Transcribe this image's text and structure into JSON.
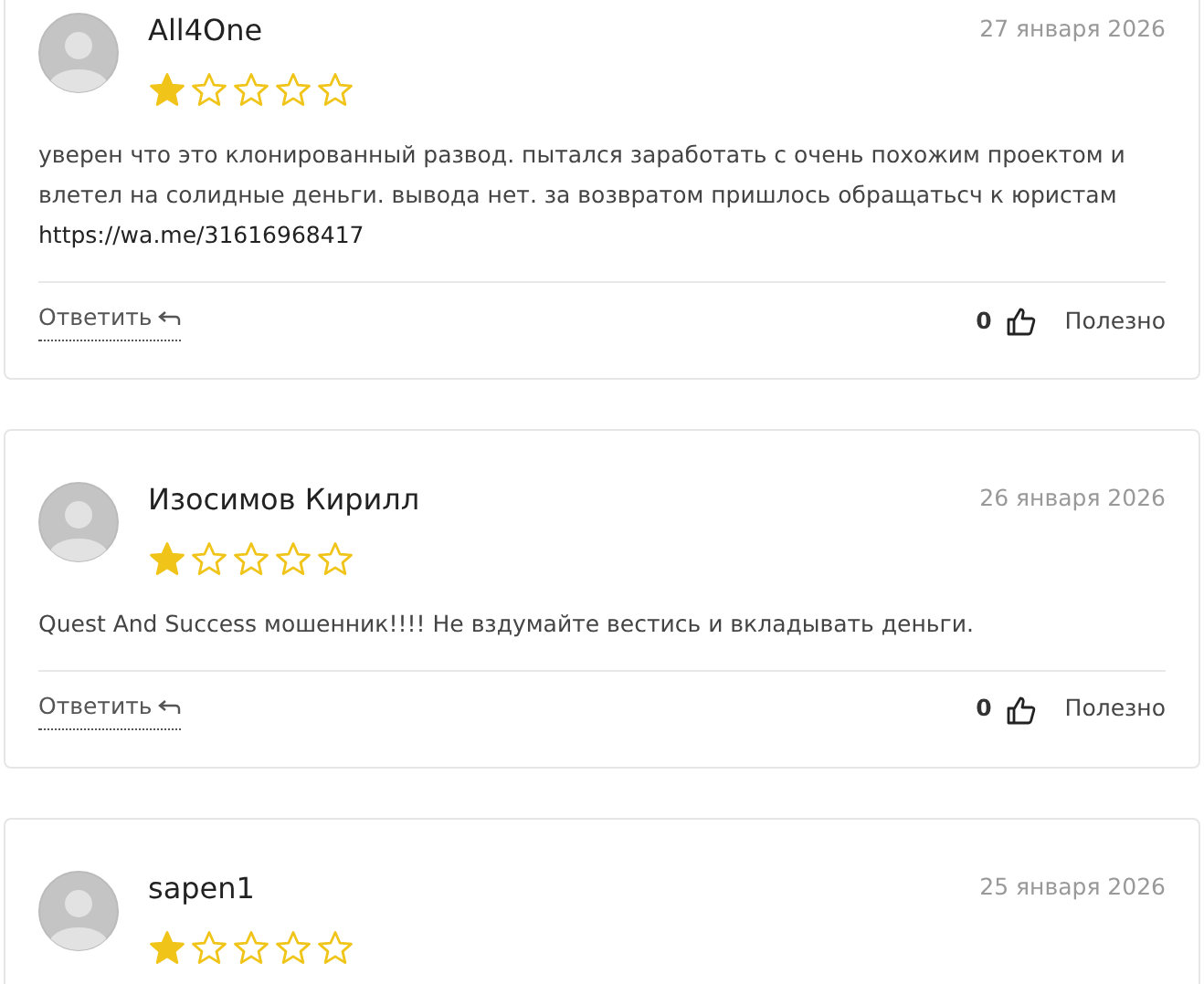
{
  "reviews": [
    {
      "author": "All4One",
      "date": "27 января 2026",
      "stars": 1,
      "text": "уверен что это клонированный развод. пытался заработать с очень похожим проектом и влетел на солидные деньги. вывода нет. за возвратом пришлось обращатьсч к юристам",
      "link": "https://wa.me/31616968417",
      "reply": "Ответить",
      "likes": "0",
      "helpful": "Полезно"
    },
    {
      "author": "Изосимов Кирилл",
      "date": "26 января 2026",
      "stars": 1,
      "text": "Quest And Success мошенник!!!! Не вздумайте вестись и вкладывать деньги.",
      "reply": "Ответить",
      "likes": "0",
      "helpful": "Полезно"
    },
    {
      "author": "sapen1",
      "date": "25 января 2026",
      "stars": 1
    }
  ]
}
